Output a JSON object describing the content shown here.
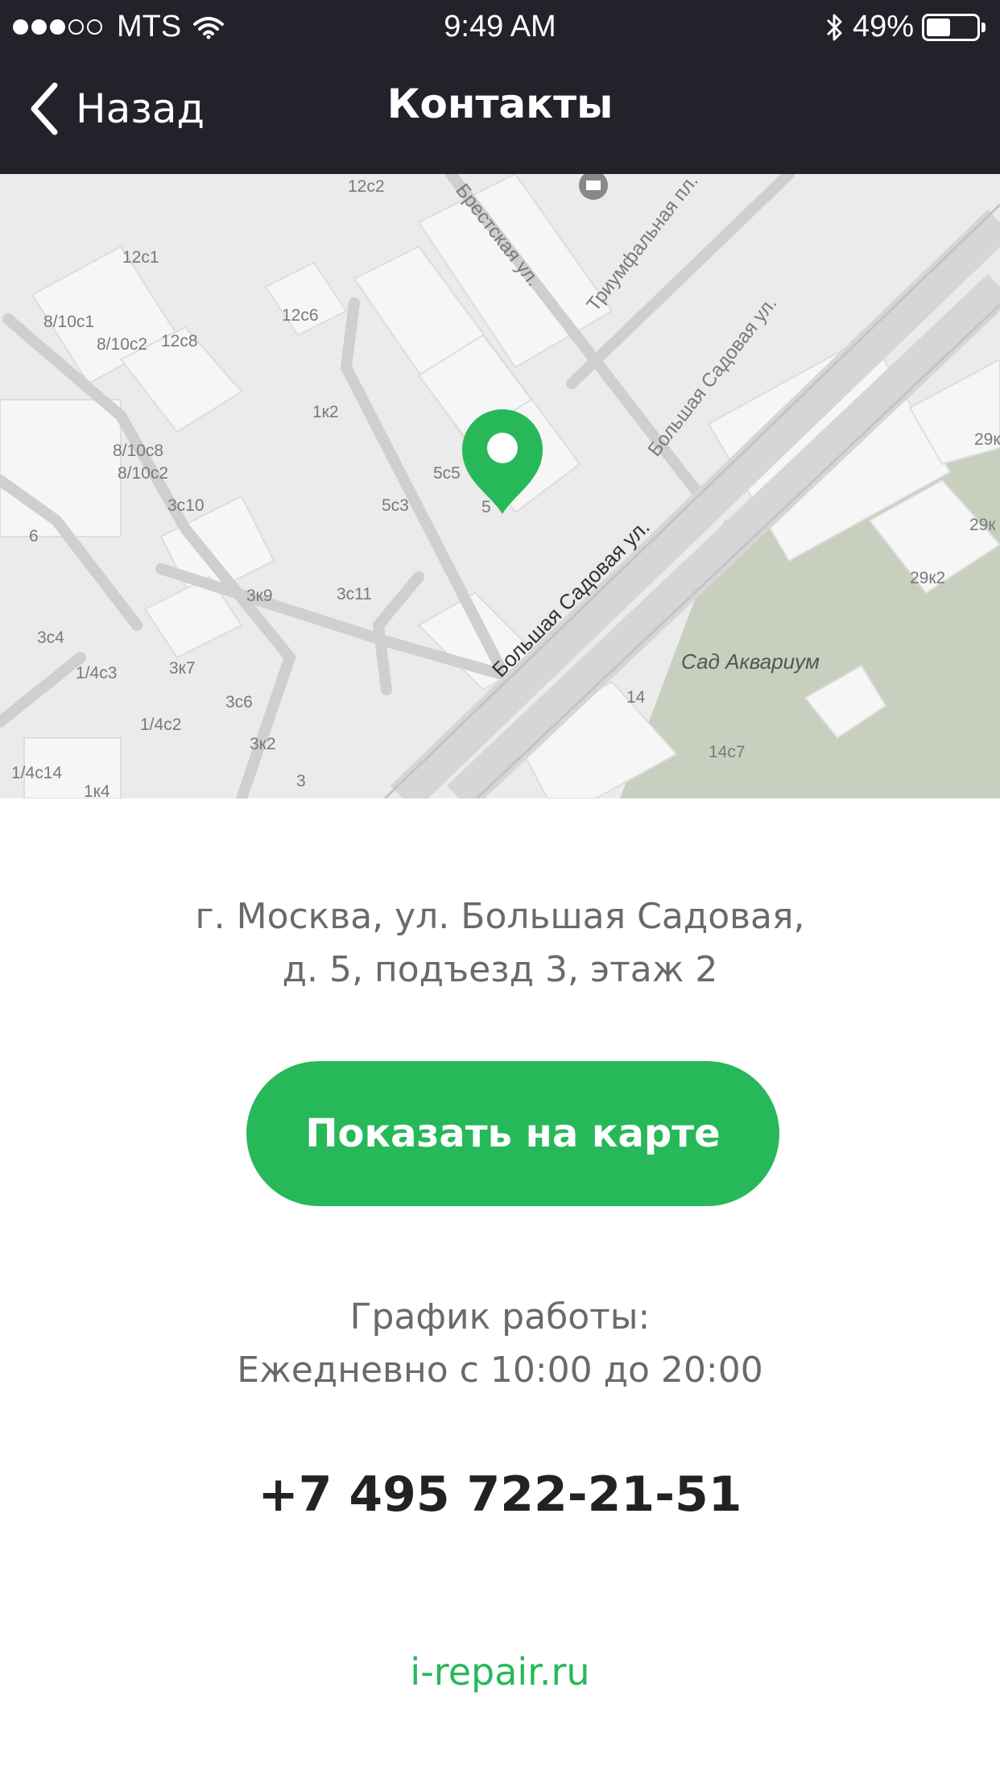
{
  "status_bar": {
    "carrier": "MTS",
    "time": "9:49 AM",
    "battery": "49%",
    "battery_level": 0.49,
    "signal_bars_filled": 3,
    "signal_bars_total": 5
  },
  "nav": {
    "back_label": "Назад",
    "title": "Контакты"
  },
  "map": {
    "labels": {
      "brestskaya": "Брестская ул.",
      "triumfalnaya": "Триумфальная пл.",
      "sadovaya_upper": "Большая Садовая ул.",
      "sadovaya_lower": "Большая Садовая ул.",
      "aquarium": "Сад Аквариум",
      "b_12c2": "12с2",
      "b_12c1": "12с1",
      "b_8_10c1": "8/10с1",
      "b_8_10c2": "8/10с2",
      "b_12c8": "12с8",
      "b_12c6": "12с6",
      "b_1k2": "1к2",
      "b_8_10c8": "8/10с8",
      "b_8_10c2b": "8/10с2",
      "b_3c10": "3с10",
      "b_5c5": "5с5",
      "b_5c3": "5с3",
      "b_5": "5",
      "b_6": "6",
      "b_3k9": "3к9",
      "b_3c11": "3с11",
      "b_3c4": "3с4",
      "b_1_4c3": "1/4с3",
      "b_3k7": "3к7",
      "b_3c6": "3с6",
      "b_1_4c2": "1/4с2",
      "b_3k2": "3к2",
      "b_1_4c14": "1/4с14",
      "b_1k4": "1к4",
      "b_3": "3",
      "b_14": "14",
      "b_14c7": "14с7",
      "b_29k_a": "29к",
      "b_29k_b": "29к",
      "b_29k2": "29к2"
    },
    "colors": {
      "background": "#ebebeb",
      "building": "#f6f6f6",
      "road": "#ffffff",
      "main_road": "#d6d6d6",
      "park": "#c8cfbf",
      "pin": "#27b85a"
    }
  },
  "address": {
    "line1": "г. Москва, ул. Большая Садовая,",
    "line2": "д. 5, подъезд 3, этаж 2"
  },
  "show_map_label": "Показать на карте",
  "hours": {
    "title": "График работы:",
    "value": "Ежедневно с 10:00 до 20:00"
  },
  "phone": "+7 495 722-21-51",
  "website": "i-repair.ru",
  "colors": {
    "accent": "#27b85a",
    "header_bg": "#22222a",
    "text_gray": "#6a6a6a",
    "text_dark": "#222222"
  }
}
